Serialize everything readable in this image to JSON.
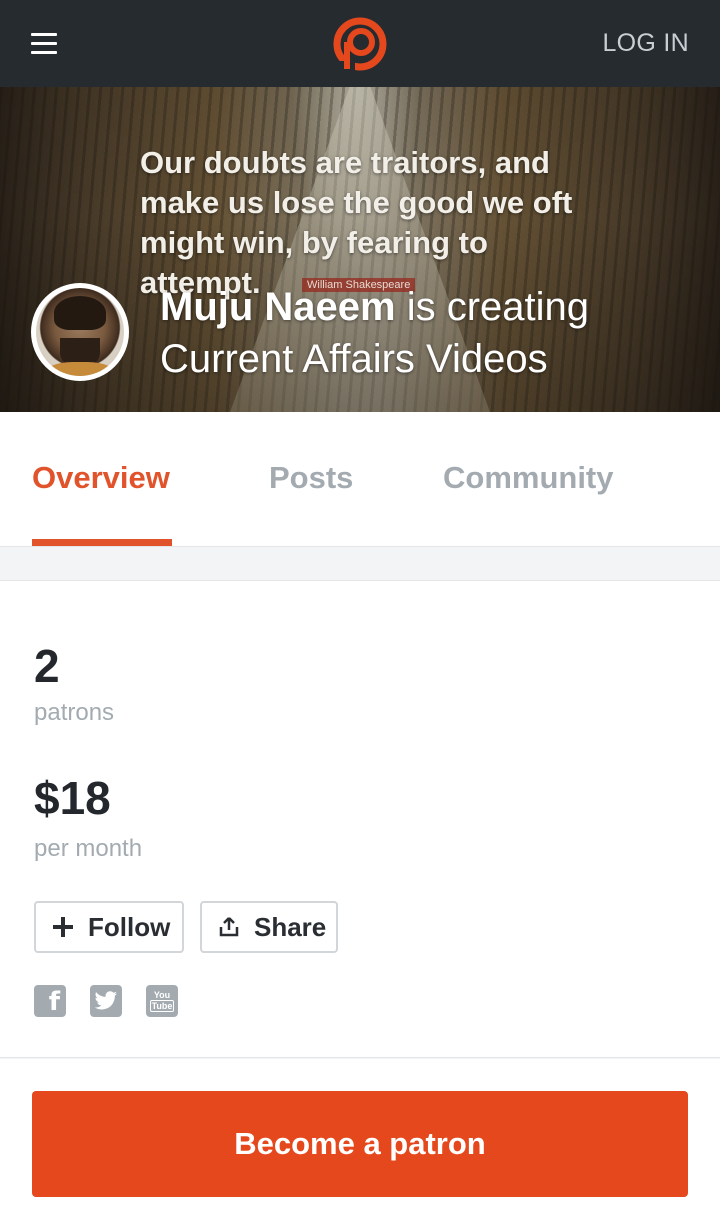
{
  "header": {
    "menu_icon": "hamburger-menu-icon",
    "logo_icon": "patreon-logo-icon",
    "login_label": "LOG IN",
    "accent_color": "#e5481c"
  },
  "hero": {
    "quote": "Our doubts are traitors, and make us lose the good we oft might win, by fearing to attempt.",
    "quote_author": "William Shakespeare",
    "creator_name": "Muju Naeem",
    "creating_text": " is creating",
    "project": "Current Affairs Videos"
  },
  "tabs": [
    {
      "label": "Overview",
      "active": true
    },
    {
      "label": "Posts",
      "active": false
    },
    {
      "label": "Community",
      "active": false
    }
  ],
  "stats": {
    "patrons_count": "2",
    "patrons_label": "patrons",
    "amount": "$18",
    "amount_label": "per month"
  },
  "actions": {
    "follow_label": "Follow",
    "share_label": "Share"
  },
  "social": {
    "facebook_glyph": "f",
    "youtube_top": "You",
    "youtube_bottom": "Tube"
  },
  "cta": {
    "label": "Become a patron"
  }
}
